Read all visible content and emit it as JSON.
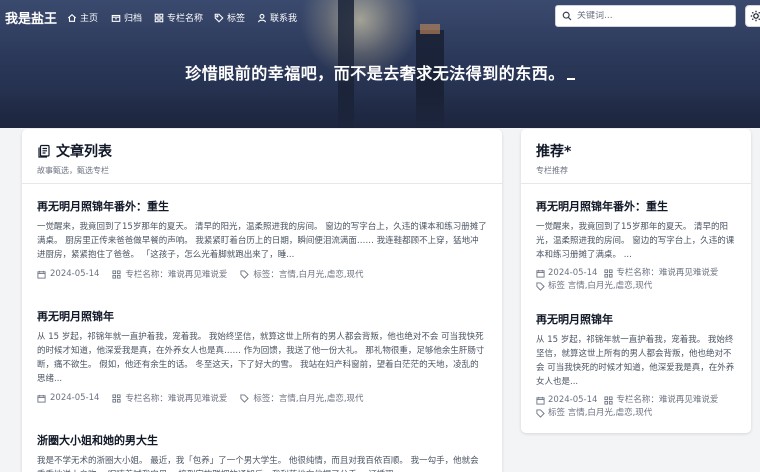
{
  "brand": "我是盐王",
  "nav": [
    {
      "label": "主页",
      "icon": "home-icon"
    },
    {
      "label": "归档",
      "icon": "archive-icon"
    },
    {
      "label": "专栏名称",
      "icon": "grid-icon"
    },
    {
      "label": "标签",
      "icon": "tag-icon"
    },
    {
      "label": "联系我",
      "icon": "user-icon"
    }
  ],
  "search": {
    "placeholder": "关键词..."
  },
  "motto": "珍惜眼前的幸福吧，而不是去奢求无法得到的东西。",
  "main": {
    "title": "文章列表",
    "subtitle": "故事甄选，甄选专栏",
    "posts": [
      {
        "title": "再无明月照锦年番外：重生",
        "excerpt": "一觉醒来，我竟回到了15岁那年的夏天。 清早的阳光，温柔照进我的房间。 窗边的写字台上，久违的课本和练习册摊了满桌。 厨房里正传来爸爸做早餐的声响。 我紧紧盯着台历上的日期，瞬间便泪流满面…… 我连鞋都顾不上穿，猛地冲进厨房，紧紧抱住了爸爸。 「这孩子，怎么光着脚就跑出来了，睡...",
        "date": "2024-05-14",
        "column": "专栏名称：难说再见难说爱",
        "tags": "标签：言情,白月光,虐恋,现代"
      },
      {
        "title": "再无明月照锦年",
        "excerpt": "从 15 岁起，祁锦年就一直护着我，宠着我。 我始终坚信，就算这世上所有的男人都会背叛，他也绝对不会 可当我快死的时候才知道，他深爱我是真，在外养女人也是真…… 作为回馈，我送了他一份大礼。 那礼物很重，足够他余生肝肠寸断，痛不欲生。 假如，他还有余生的话。 冬至这天，下了好大的雪。 我站在妇产科窗前，望着白茫茫的天地，凌乱的思绪...",
        "date": "2024-05-14",
        "column": "专栏名称：难说再见难说爱",
        "tags": "标签：言情,白月光,虐恋,现代"
      },
      {
        "title": "浙圈大小姐和她的男大生",
        "excerpt": "我是不学无术的浙圈大小姐。 最近，我「包养」了一个男大学生。 他很纯情，而且对我百依百顺。 我一勾手，他就会乖乖地送上亲吻。 呢喃着喊我宝贝。 接到家族联姻的通知后，我利落地向他提了分手。 订婚现",
        "date": "",
        "column": "",
        "tags": ""
      }
    ]
  },
  "side": {
    "title": "推荐*",
    "subtitle": "专栏推荐",
    "posts": [
      {
        "title": "再无明月照锦年番外：重生",
        "excerpt": "一觉醒来，我竟回到了15岁那年的夏天。 清早的阳光，温柔照进我的房间。 窗边的写字台上，久违的课本和练习册摊了满桌。 ...",
        "date": "2024-05-14",
        "column": "专栏名称：难说再见难说爱",
        "tags": "标签 言情,白月光,虐恋,现代"
      },
      {
        "title": "再无明月照锦年",
        "excerpt": "从 15 岁起，祁锦年就一直护着我，宠着我。 我始终坚信，就算这世上所有的男人都会背叛，他也绝对不会 可当我快死的时候才知道，他深爱我是真，在外养女人也是...",
        "date": "2024-05-14",
        "column": "专栏名称：难说再见难说爱",
        "tags": "标签 言情,白月光,虐恋,现代"
      }
    ]
  }
}
